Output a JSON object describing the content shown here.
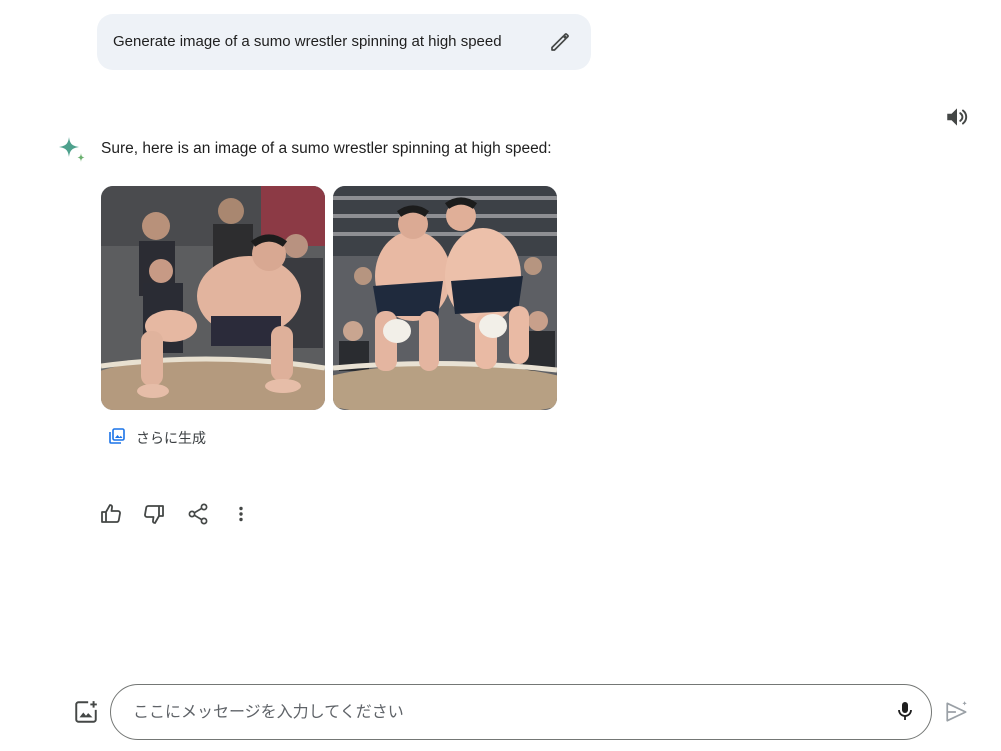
{
  "user_prompt": {
    "text": "Generate image of a sumo wrestler spinning at high speed",
    "edit_icon": "pencil-icon"
  },
  "response": {
    "text": "Sure, here is an image of a sumo wrestler spinning at high speed:",
    "avatar_icon": "sparkle-icon",
    "read_aloud_icon": "speaker-icon",
    "images": [
      {
        "name": "generated-image-1",
        "subject": "sumo wrestler crouching in the ring"
      },
      {
        "name": "generated-image-2",
        "subject": "two sumo wrestlers grappling"
      }
    ],
    "generate_more_label": "さらに生成"
  },
  "actions": [
    {
      "name": "thumbs-up-icon"
    },
    {
      "name": "thumbs-down-icon"
    },
    {
      "name": "share-icon"
    },
    {
      "name": "more-vert-icon"
    }
  ],
  "composer": {
    "placeholder": "ここにメッセージを入力してください",
    "value": "",
    "mic_icon": "mic-icon",
    "add_image_icon": "add-image-icon",
    "send_icon": "send-icon"
  },
  "colors": {
    "user_bubble_bg": "#eef2f7",
    "text_primary": "#1f1f1f",
    "icon_gray": "#444746",
    "accent_blue": "#1a73e8"
  }
}
